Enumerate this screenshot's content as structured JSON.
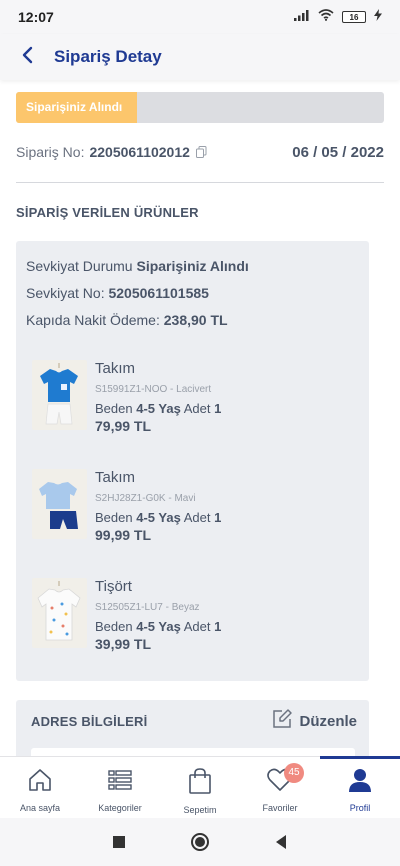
{
  "status_bar": {
    "time": "12:07",
    "battery": "16"
  },
  "header": {
    "title": "Sipariş Detay"
  },
  "progress": {
    "label": "Siparişiniz Alındı",
    "fraction": 0.33,
    "fill_color": "#fcc66c",
    "track_color": "#dcdde1"
  },
  "order": {
    "number_label": "Sipariş No:",
    "number_value": "2205061102012",
    "date": "06 / 05 / 2022"
  },
  "products_section": {
    "title": "SİPARİŞ VERİLEN ÜRÜNLER"
  },
  "shipment": {
    "status_label": "Sevkiyat Durumu",
    "status_value": "Siparişiniz Alındı",
    "no_label": "Sevkiyat No:",
    "no_value": "5205061101585",
    "payment_label": "Kapıda Nakit Ödeme:",
    "payment_value": "238,90 TL"
  },
  "products": [
    {
      "name": "Takım",
      "code": "S15991Z1-NOO - Lacivert",
      "size_label": "Beden",
      "size_value": "4-5 Yaş",
      "qty_label": "Adet",
      "qty_value": "1",
      "price": "79,99 TL",
      "image_icon": "blue-tshirt-shorts-set-icon"
    },
    {
      "name": "Takım",
      "code": "S2HJ28Z1-G0K - Mavi",
      "size_label": "Beden",
      "size_value": "4-5 Yaş",
      "qty_label": "Adet",
      "qty_value": "1",
      "price": "99,99 TL",
      "image_icon": "light-blue-tshirt-navy-shorts-icon"
    },
    {
      "name": "Tişört",
      "code": "S12505Z1-LU7 - Beyaz",
      "size_label": "Beden",
      "size_value": "4-5 Yaş",
      "qty_label": "Adet",
      "qty_value": "1",
      "price": "39,99 TL",
      "image_icon": "white-patterned-tshirt-icon"
    }
  ],
  "address": {
    "title": "ADRES BİLGİLERİ",
    "edit_label": "Düzenle"
  },
  "bottom_nav": {
    "items": [
      {
        "label": "Ana sayfa",
        "icon": "home-icon"
      },
      {
        "label": "Kategoriler",
        "icon": "categories-list-icon"
      },
      {
        "label": "Sepetim",
        "icon": "shopping-bag-icon"
      },
      {
        "label": "Favoriler",
        "icon": "heart-icon",
        "badge": "45"
      },
      {
        "label": "Profil",
        "icon": "profile-icon",
        "active": true
      }
    ]
  },
  "colors": {
    "brand": "#1f3a93",
    "text": "#4a5568",
    "card_bg": "#eceef2",
    "badge": "#f08a80"
  }
}
